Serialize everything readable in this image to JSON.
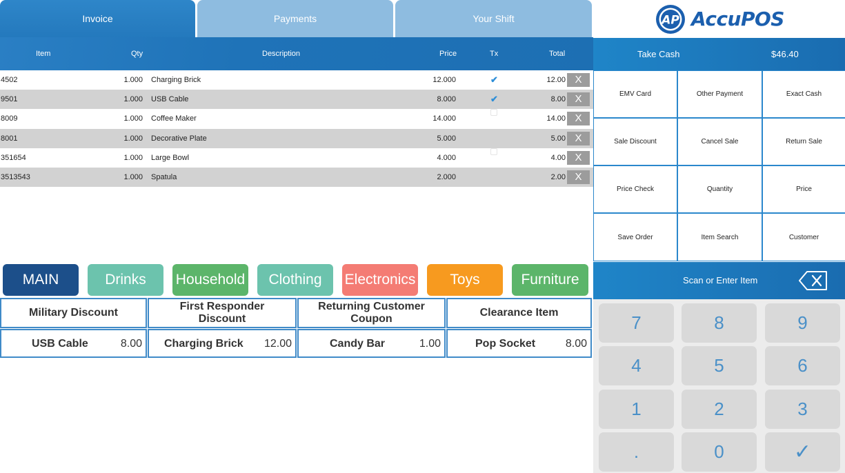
{
  "tabs": [
    "Invoice",
    "Payments",
    "Your Shift"
  ],
  "table": {
    "headers": {
      "item": "Item",
      "qty": "Qty",
      "description": "Description",
      "price": "Price",
      "tx": "Tx",
      "total": "Total"
    },
    "rows": [
      {
        "item": "4502",
        "qty": "1.000",
        "description": "Charging Brick",
        "price": "12.000",
        "taxed": true,
        "total": "12.00",
        "remove": "X"
      },
      {
        "item": "9501",
        "qty": "1.000",
        "description": "USB Cable",
        "price": "8.000",
        "taxed": true,
        "total": "8.00",
        "remove": "X"
      },
      {
        "item": "8009",
        "qty": "1.000",
        "description": "Coffee Maker",
        "price": "14.000",
        "taxed": false,
        "total": "14.00",
        "remove": "X"
      },
      {
        "item": "8001",
        "qty": "1.000",
        "description": "Decorative Plate",
        "price": "5.000",
        "taxed": false,
        "total": "5.00",
        "remove": "X"
      },
      {
        "item": "351654",
        "qty": "1.000",
        "description": "Large Bowl",
        "price": "4.000",
        "taxed": false,
        "total": "4.00",
        "remove": "X"
      },
      {
        "item": "3513543",
        "qty": "1.000",
        "description": "Spatula",
        "price": "2.000",
        "taxed": false,
        "total": "2.00",
        "remove": "X"
      }
    ]
  },
  "categories": [
    {
      "label": "MAIN",
      "color": "#1c4f8a"
    },
    {
      "label": "Drinks",
      "color": "#6cc3ad"
    },
    {
      "label": "Household",
      "color": "#5cb56a"
    },
    {
      "label": "Clothing",
      "color": "#6cc3ad"
    },
    {
      "label": "Electronics",
      "color": "#f47c74"
    },
    {
      "label": "Toys",
      "color": "#f79a1f"
    },
    {
      "label": "Furniture",
      "color": "#5cb56a"
    }
  ],
  "quick_keys": {
    "discounts": [
      "Military Discount",
      "First Responder Discount",
      "Returning Customer Coupon",
      "Clearance Item"
    ],
    "items": [
      {
        "name": "USB Cable",
        "price": "8.00"
      },
      {
        "name": "Charging Brick",
        "price": "12.00"
      },
      {
        "name": "Candy Bar",
        "price": "1.00"
      },
      {
        "name": "Pop Socket",
        "price": "8.00"
      }
    ]
  },
  "brand": {
    "logo_text": "AccuPOS",
    "logo_mark": "AP",
    "color": "#1b5fae"
  },
  "take_cash": {
    "label": "Take Cash",
    "amount": "$46.40"
  },
  "functions": [
    "EMV Card",
    "Other Payment",
    "Exact Cash",
    "Sale Discount",
    "Cancel Sale",
    "Return Sale",
    "Price Check",
    "Quantity",
    "Price",
    "Save Order",
    "Item Search",
    "Customer"
  ],
  "scan": {
    "label": "Scan or Enter Item",
    "backspace_icon": "backspace-icon"
  },
  "keypad": [
    "7",
    "8",
    "9",
    "4",
    "5",
    "6",
    "1",
    "2",
    "3",
    ".",
    "0",
    "✓"
  ]
}
